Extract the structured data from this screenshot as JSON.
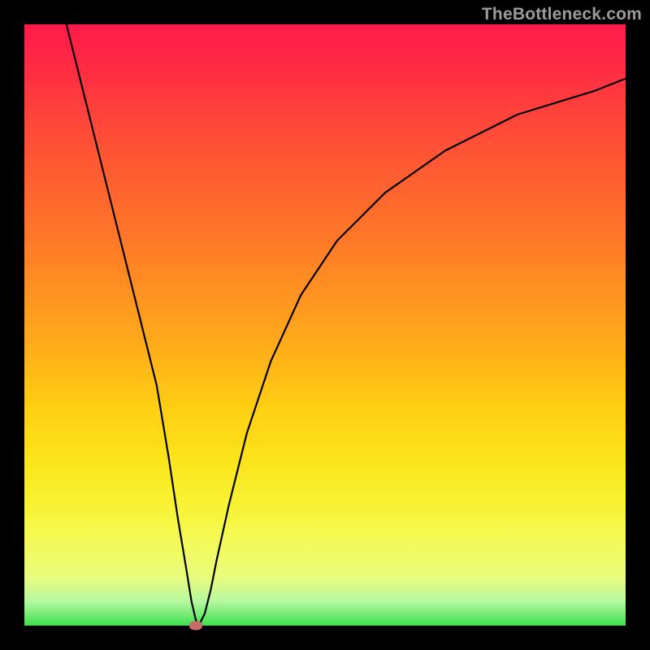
{
  "watermark": "TheBottleneck.com",
  "chart_data": {
    "type": "line",
    "title": "",
    "xlabel": "",
    "ylabel": "",
    "xlim": [
      0,
      100
    ],
    "ylim": [
      0,
      100
    ],
    "series": [
      {
        "name": "curve",
        "x": [
          7,
          10,
          13,
          16,
          19,
          22,
          24,
          25.5,
          27,
          27.8,
          28.5,
          29,
          30,
          31,
          32,
          34,
          37,
          41,
          46,
          52,
          60,
          70,
          82,
          95,
          100
        ],
        "y": [
          100,
          88,
          76,
          64,
          52,
          40,
          28,
          18,
          9,
          4,
          1,
          0,
          2,
          6,
          11,
          20,
          32,
          44,
          55,
          64,
          72,
          79,
          85,
          89,
          91
        ]
      }
    ],
    "marker": {
      "x": 28.5,
      "y": 0
    },
    "colors": {
      "gradient_top": "#ff1a4a",
      "gradient_bottom": "#3de04e",
      "line": "#000000",
      "marker": "#c96b6b",
      "frame": "#000000"
    }
  }
}
